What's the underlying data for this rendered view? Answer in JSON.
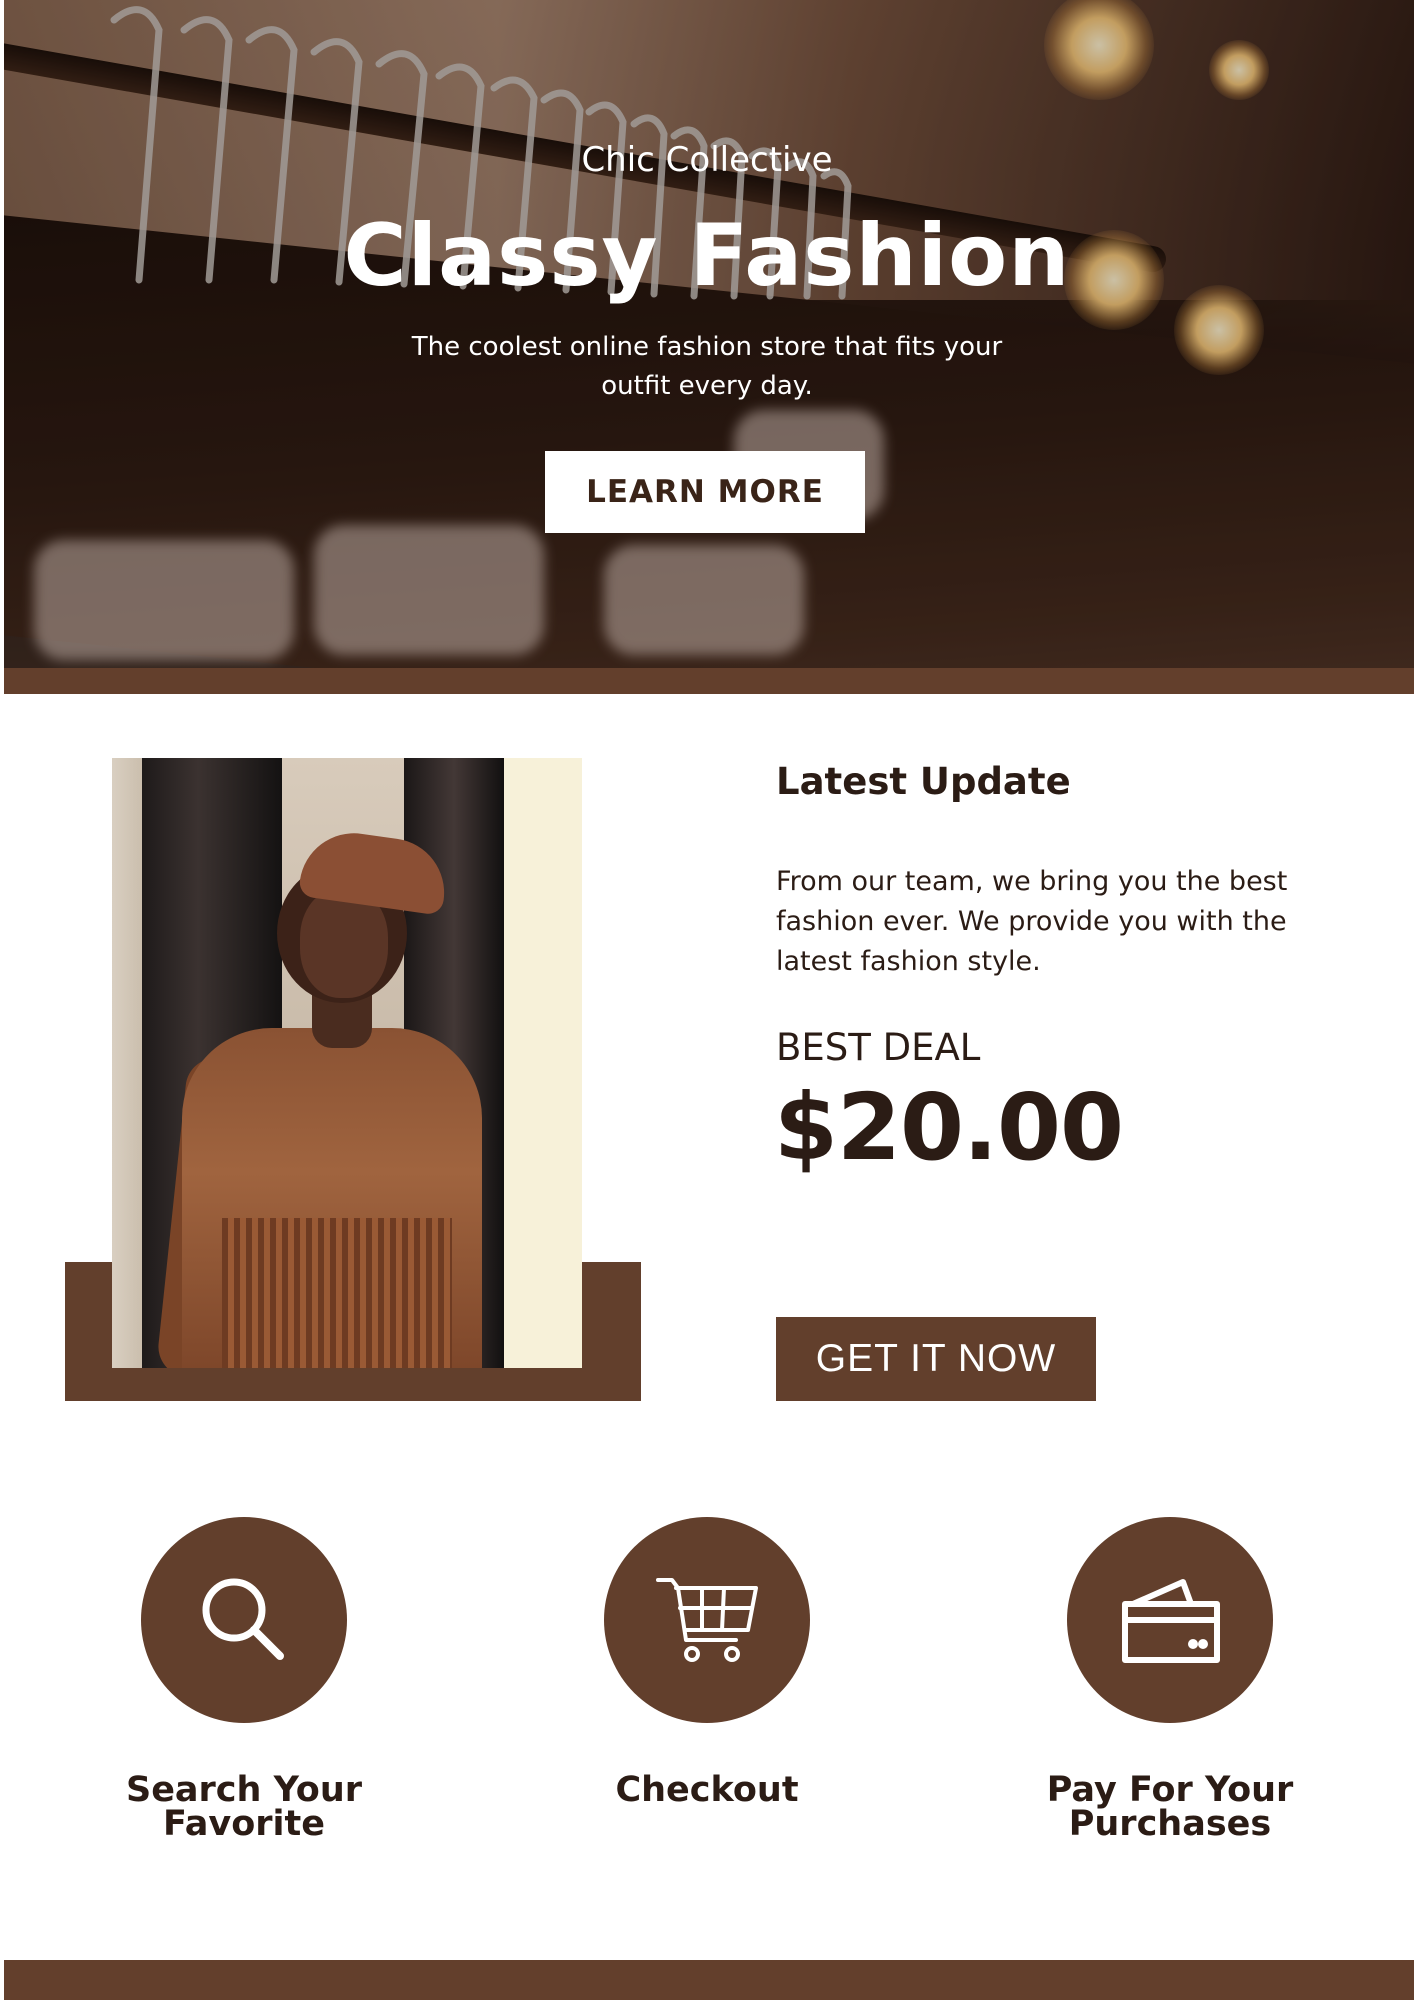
{
  "hero": {
    "brand": "Chic Collective",
    "title": "Classy Fashion",
    "description": "The coolest online fashion store that fits your outfit every day.",
    "cta_label": "LEARN MORE"
  },
  "latest_update": {
    "title": "Latest Update",
    "description": "From our team, we bring you the best fashion ever. We provide you with the latest fashion style.",
    "deal_label": "BEST DEAL",
    "deal_price": "$20.00",
    "cta_label": "GET IT NOW"
  },
  "features": [
    {
      "icon": "search-icon",
      "label_line1": "Search Your",
      "label_line2": "Favorite"
    },
    {
      "icon": "shopping-cart-icon",
      "label_line1": "Checkout",
      "label_line2": ""
    },
    {
      "icon": "credit-card-icon",
      "label_line1": "Pay For Your",
      "label_line2": "Purchases"
    }
  ],
  "colors": {
    "accent_brown": "#623f2c",
    "text_dark": "#2b1c15",
    "white": "#ffffff"
  }
}
